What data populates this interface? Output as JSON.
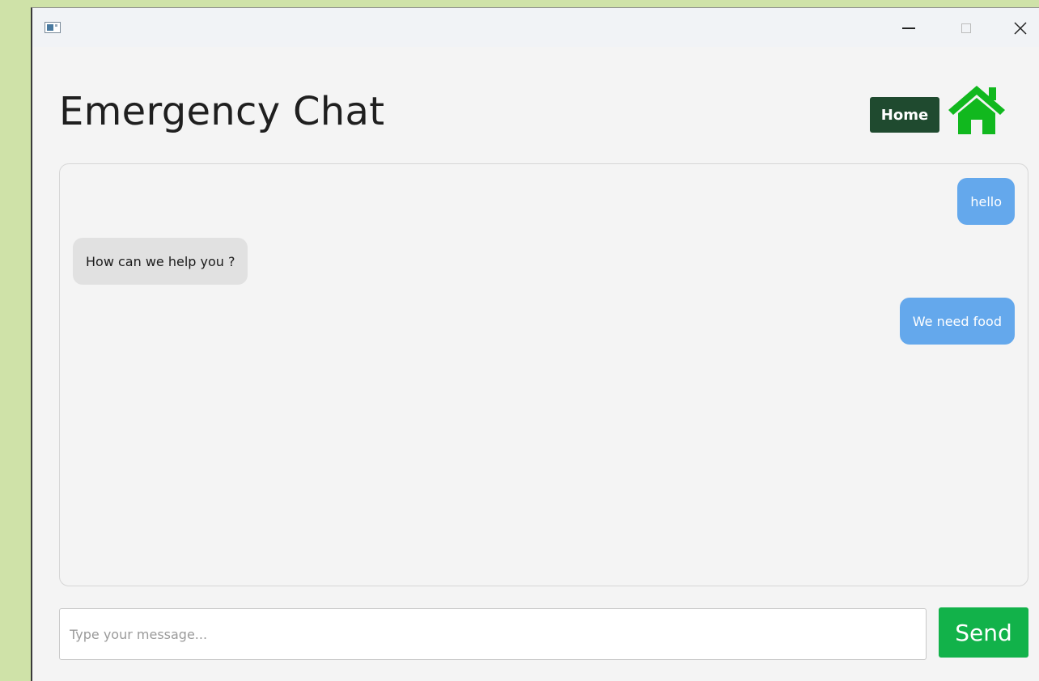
{
  "window": {
    "icons": {
      "app": "app-window-icon",
      "minimize": "minimize-icon",
      "maximize": "maximize-icon",
      "close": "close-icon"
    }
  },
  "header": {
    "title": "Emergency Chat",
    "home_label": "Home",
    "home_icon": "home-icon"
  },
  "chat": {
    "messages": [
      {
        "sender": "user",
        "text": "hello"
      },
      {
        "sender": "support",
        "text": "How can we help you ?"
      },
      {
        "sender": "user",
        "text": "We need food"
      }
    ]
  },
  "composer": {
    "placeholder": "Type your message...",
    "value": "",
    "send_label": "Send"
  },
  "colors": {
    "home_button": "#1f4a2f",
    "home_icon": "#11b81e",
    "user_bubble": "#64a8ec",
    "support_bubble": "#e1e1e1",
    "send_button": "#12b24a",
    "desktop_background": "#cfe2a8"
  }
}
